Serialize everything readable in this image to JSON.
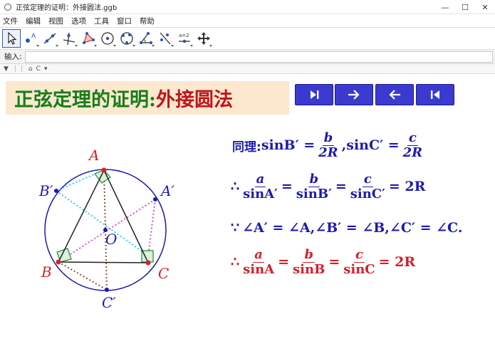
{
  "window": {
    "title": "正弦定理的证明：外接圆法.ggb",
    "minimize": "—",
    "maximize": "☐",
    "close": "✕"
  },
  "menu": [
    "文件",
    "编辑",
    "视图",
    "选项",
    "工具",
    "窗口",
    "帮助"
  ],
  "toolbar": {
    "tools": [
      "move-tool",
      "point-tool",
      "line-tool",
      "perpendicular-line-tool",
      "polygon-tool",
      "circle-tool",
      "circle-three-points-tool",
      "angle-tool",
      "reflect-tool",
      "slider-tool",
      "move-graphics-view-tool"
    ],
    "slider_text": "a=2"
  },
  "input_bar": {
    "label": "输入:",
    "value": ""
  },
  "view_bar": {
    "home": "⌂",
    "undo": "C"
  },
  "slide_title": {
    "part1": "正弦定理的证明:",
    "part2": "外接圆法"
  },
  "nav_buttons": [
    "play-step-forward",
    "next",
    "previous",
    "restart"
  ],
  "points": {
    "A": "A",
    "B": "B",
    "C": "C",
    "A_prime": "A′",
    "B_prime": "B′",
    "C_prime": "C′",
    "O": "O"
  },
  "equations": {
    "line1": {
      "prefix": "同理:",
      "lhs1": "sinB′ =",
      "frac1_num": "b",
      "frac1_den": "2R",
      "sep": ",sinC′ =",
      "frac2_num": "c",
      "frac2_den": "2R"
    },
    "line2": {
      "therefore": "∴",
      "f1_num": "a",
      "f1_den": "sinA′",
      "f2_num": "b",
      "f2_den": "sinB′",
      "f3_num": "c",
      "f3_den": "sinC′",
      "eq": "=",
      "tail": "= 2R"
    },
    "line3": {
      "because": "∵",
      "text": "∠A′ = ∠A,∠B′ = ∠B,∠C′ = ∠C."
    },
    "line4": {
      "therefore": "∴",
      "f1_num": "a",
      "f1_den": "sinA",
      "f2_num": "b",
      "f2_den": "sinB",
      "f3_num": "c",
      "f3_den": "sinC",
      "eq": "=",
      "tail": "= 2R"
    }
  },
  "colors": {
    "title_bg": "#fbe8cf",
    "title_green": "#177d1a",
    "title_red": "#c0141c",
    "nav_button": "#3b3ad0",
    "math_blue": "#1d1ab0",
    "math_red": "#d4202a",
    "cyan_dashed": "#22d3e6",
    "magenta_dashed": "#e048e0",
    "brown_dotted": "#8b5a2b"
  }
}
